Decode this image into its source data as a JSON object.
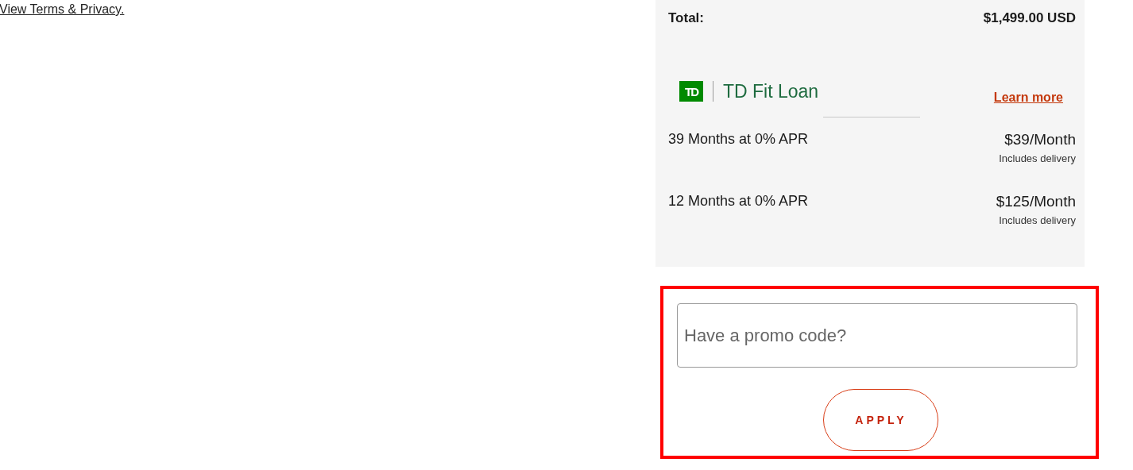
{
  "terms_link": "View Terms & Privacy.",
  "summary": {
    "total_label": "Total:",
    "total_value": "$1,499.00 USD",
    "financing": {
      "logo_mark": "TD",
      "provider": "TD Fit Loan",
      "learn_more": "Learn more",
      "plans": [
        {
          "term": "39 Months at 0% APR",
          "payment": "$39/Month",
          "note": "Includes delivery"
        },
        {
          "term": "12 Months at 0% APR",
          "payment": "$125/Month",
          "note": "Includes delivery"
        }
      ]
    }
  },
  "promo": {
    "placeholder": "Have a promo code?",
    "button": "APPLY"
  }
}
